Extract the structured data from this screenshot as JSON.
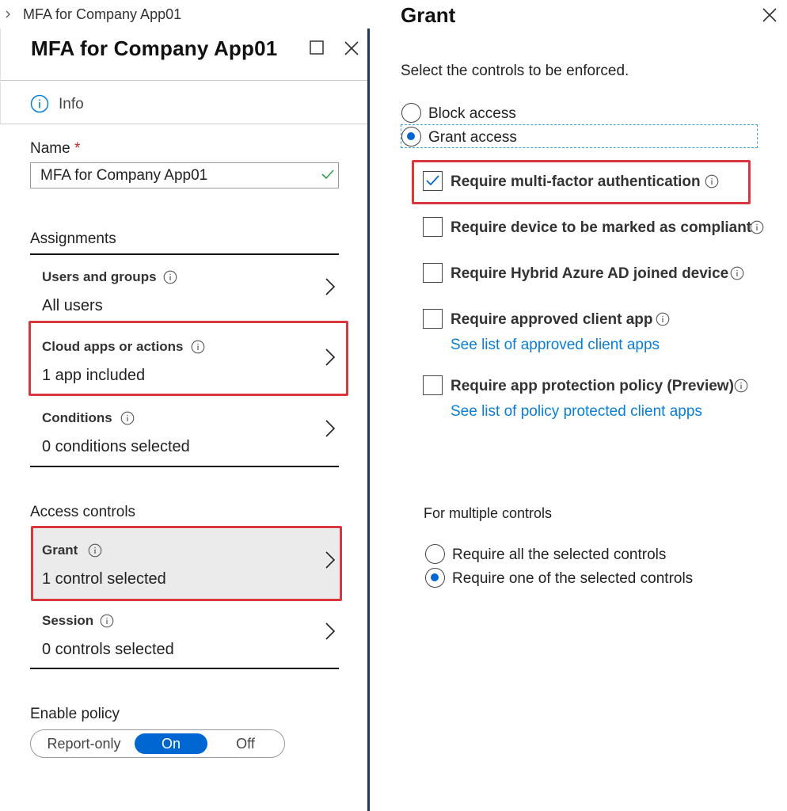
{
  "breadcrumb": {
    "item": "MFA for Company App01"
  },
  "left_blade": {
    "title": "MFA for Company App01",
    "info_label": "Info",
    "name_label": "Name",
    "required_mark": "*",
    "name_value": "MFA for Company App01",
    "assignments_heading": "Assignments",
    "assignments": [
      {
        "title": "Users and groups",
        "value": "All users"
      },
      {
        "title": "Cloud apps or actions",
        "value": "1 app included"
      },
      {
        "title": "Conditions",
        "value": "0 conditions selected"
      }
    ],
    "access_heading": "Access controls",
    "access": [
      {
        "title": "Grant",
        "value": "1 control selected"
      },
      {
        "title": "Session",
        "value": "0 controls selected"
      }
    ],
    "enable_policy_label": "Enable policy",
    "toggle": {
      "options": [
        "Report-only",
        "On",
        "Off"
      ],
      "selected": "On"
    }
  },
  "grant_blade": {
    "title": "Grant",
    "subtitle": "Select the controls to be enforced.",
    "access_options": [
      {
        "label": "Block access",
        "selected": false
      },
      {
        "label": "Grant access",
        "selected": true
      }
    ],
    "controls": [
      {
        "label": "Require multi-factor authentication",
        "checked": true
      },
      {
        "label": "Require device to be marked as compliant",
        "checked": false
      },
      {
        "label": "Require Hybrid Azure AD joined device",
        "checked": false
      },
      {
        "label": "Require approved client app",
        "checked": false,
        "link": "See list of approved client apps"
      },
      {
        "label": "Require app protection policy (Preview)",
        "checked": false,
        "link": "See list of policy protected client apps"
      }
    ],
    "multiple_heading": "For multiple controls",
    "multiple_options": [
      {
        "label": "Require all the selected controls",
        "selected": false
      },
      {
        "label": "Require one of the selected controls",
        "selected": true
      }
    ]
  },
  "colors": {
    "accent": "#0067d2",
    "highlight": "#d9363e",
    "link": "#0a7ed6",
    "success": "#2fa14a"
  }
}
